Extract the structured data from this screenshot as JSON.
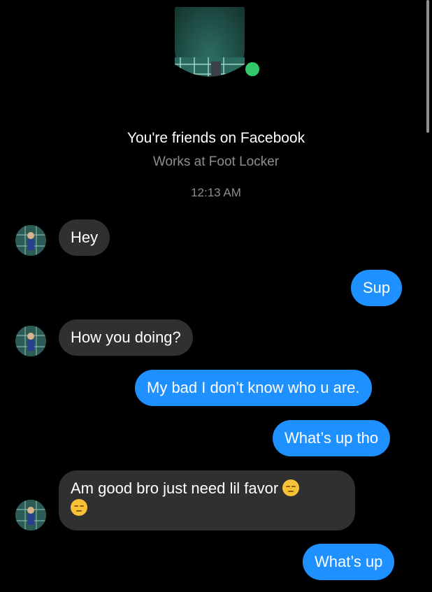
{
  "header": {
    "friends_text": "You're friends on Facebook",
    "works_text": "Works at Foot Locker",
    "timestamp": "12:13 AM",
    "online_color": "#31c76a"
  },
  "colors": {
    "incoming_bubble": "#303030",
    "outgoing_bubble": "#1e90ff",
    "background": "#000000"
  },
  "messages": [
    {
      "direction": "incoming",
      "text": "Hey"
    },
    {
      "direction": "outgoing",
      "text": "Sup"
    },
    {
      "direction": "incoming",
      "text": "How you doing?"
    },
    {
      "direction": "outgoing",
      "text": "My bad I don’t know who u are."
    },
    {
      "direction": "outgoing",
      "text": "What’s up tho"
    },
    {
      "direction": "incoming",
      "text": "Am good bro just need lil favor",
      "emoji": "pensive-face-emoji"
    },
    {
      "direction": "outgoing",
      "text": "What’s up"
    }
  ]
}
